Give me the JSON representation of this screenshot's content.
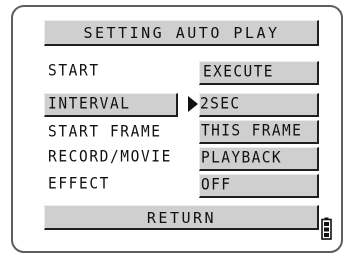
{
  "menu": {
    "title": "SETTING AUTO PLAY",
    "rows": [
      {
        "label": "START",
        "value": "EXECUTE"
      },
      {
        "label": "INTERVAL",
        "value": "2SEC"
      },
      {
        "label": "START FRAME",
        "value": "THIS FRAME"
      },
      {
        "label": "RECORD/MOVIE",
        "value": "PLAYBACK"
      },
      {
        "label": "EFFECT",
        "value": "OFF"
      }
    ],
    "selected_row": "INTERVAL",
    "return_label": "RETURN"
  },
  "icons": {
    "selection_indicator": "triangle-right-icon",
    "battery": "battery-icon"
  },
  "colors": {
    "background": "#ffffff",
    "bar_fill": "#cfcfcf",
    "text": "#111111",
    "frame_border": "#5e5e5e"
  }
}
